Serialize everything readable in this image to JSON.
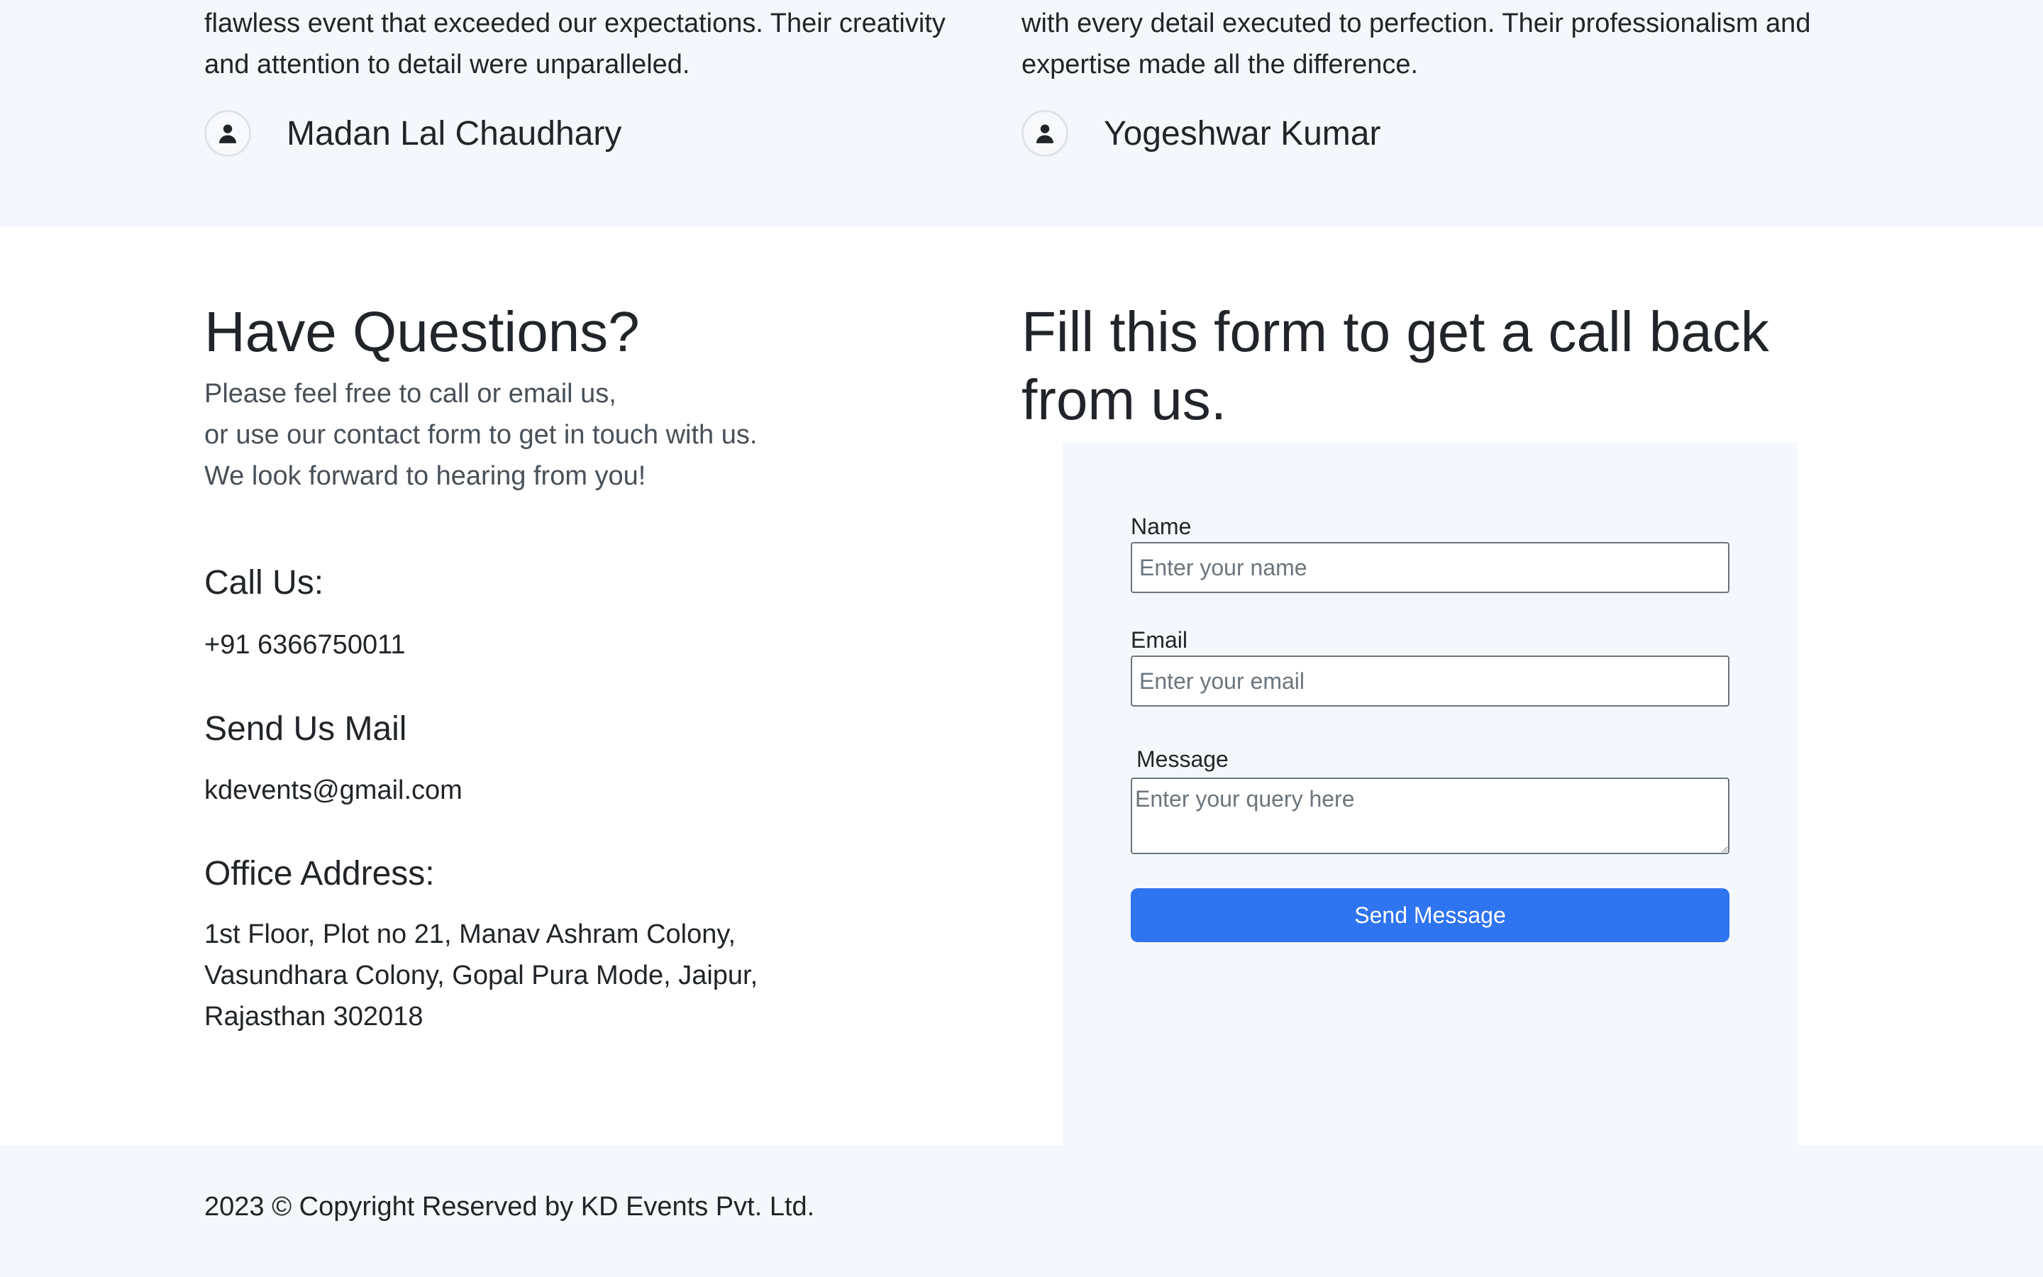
{
  "testimonials": [
    {
      "quote_lines": [
        "flawless event that exceeded our expectations. Their creativity",
        "and attention to detail were unparalleled."
      ],
      "author": "Madan Lal Chaudhary",
      "avatar_icon": "user-icon"
    },
    {
      "quote_lines": [
        "with every detail executed to perfection. Their professionalism and",
        "expertise made all the difference."
      ],
      "author": "Yogeshwar Kumar",
      "avatar_icon": "user-icon"
    }
  ],
  "contact_info": {
    "heading": "Have Questions?",
    "intro_lines": [
      "Please feel free to call or email us,",
      "or use our contact form to get in touch with us.",
      "We look forward to hearing from you!"
    ],
    "call_heading": "Call Us:",
    "phone": "+91 6366750011",
    "mail_heading": "Send Us Mail",
    "email": "kdevents@gmail.com",
    "address_heading": "Office Address:",
    "address_lines": [
      "1st Floor, Plot no 21, Manav Ashram Colony,",
      "Vasundhara Colony, Gopal Pura Mode, Jaipur,",
      "Rajasthan 302018"
    ]
  },
  "contact_form": {
    "heading_lines": [
      "Fill this form to get a call back",
      "from us."
    ],
    "name_label": "Name",
    "name_placeholder": "Enter your name",
    "name_value": "",
    "email_label": "Email",
    "email_placeholder": "Enter your email",
    "email_value": "",
    "message_label": "Message",
    "message_placeholder": "Enter your query here",
    "message_value": "",
    "submit_label": "Send Message"
  },
  "footer": {
    "copyright": "2023 © Copyright Reserved by KD Events Pvt. Ltd."
  },
  "colors": {
    "accent": "#2f74f1",
    "section_bg": "#f4f7fb",
    "text": "#212529"
  }
}
